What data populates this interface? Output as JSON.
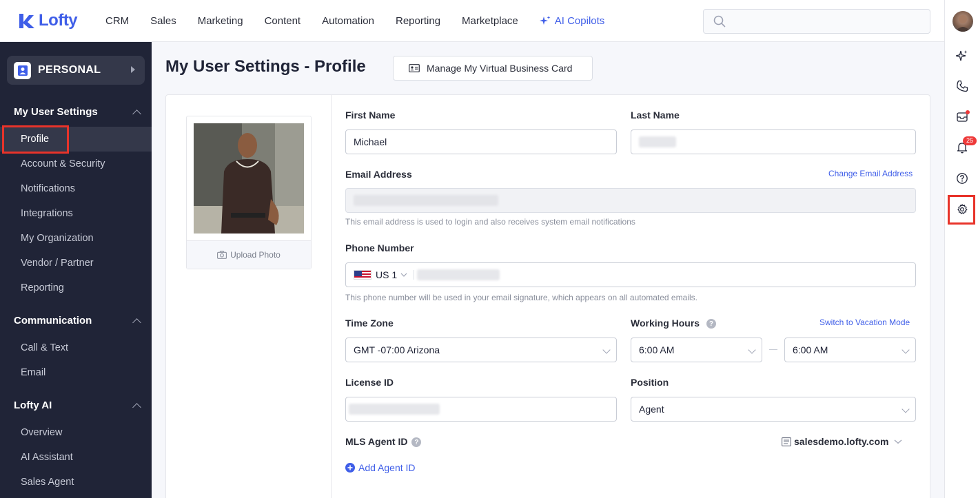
{
  "brand": {
    "name": "Lofty",
    "color": "#3f5ee8"
  },
  "nav": {
    "items": [
      "CRM",
      "Sales",
      "Marketing",
      "Content",
      "Automation",
      "Reporting",
      "Marketplace"
    ],
    "ai_label": "AI Copilots"
  },
  "search": {
    "placeholder": ""
  },
  "rail": {
    "notification_count": "25"
  },
  "sidebar": {
    "personal_label": "PERSONAL",
    "sections": [
      {
        "title": "My User Settings",
        "items": [
          "Profile",
          "Account & Security",
          "Notifications",
          "Integrations",
          "My Organization",
          "Vendor / Partner",
          "Reporting"
        ]
      },
      {
        "title": "Communication",
        "items": [
          "Call & Text",
          "Email"
        ]
      },
      {
        "title": "Lofty AI",
        "items": [
          "Overview",
          "AI Assistant",
          "Sales Agent"
        ]
      }
    ],
    "active_item": "Profile"
  },
  "page": {
    "title": "My User Settings - Profile",
    "vbc_button": "Manage My Virtual Business Card"
  },
  "photo": {
    "upload_label": "Upload Photo"
  },
  "form": {
    "first_name": {
      "label": "First Name",
      "value": "Michael"
    },
    "last_name": {
      "label": "Last Name",
      "value": ""
    },
    "email": {
      "label": "Email Address",
      "change_link": "Change Email Address",
      "hint": "This email address is used to login and also receives system email notifications"
    },
    "phone": {
      "label": "Phone Number",
      "country": "US 1",
      "hint": "This phone number will be used in your email signature, which appears on all automated emails."
    },
    "time_zone": {
      "label": "Time Zone",
      "value": "GMT -07:00 Arizona"
    },
    "working_hours": {
      "label": "Working Hours",
      "vacation_link": "Switch to Vacation Mode",
      "start": "6:00 AM",
      "end": "6:00 AM"
    },
    "license": {
      "label": "License ID"
    },
    "position": {
      "label": "Position",
      "value": "Agent"
    },
    "mls": {
      "label": "MLS Agent ID",
      "site": "salesdemo.lofty.com",
      "add_label": "Add Agent ID"
    }
  },
  "colors": {
    "sidebar_bg": "#202437",
    "highlight": "#e8332a",
    "accent": "#3f5ee8"
  }
}
